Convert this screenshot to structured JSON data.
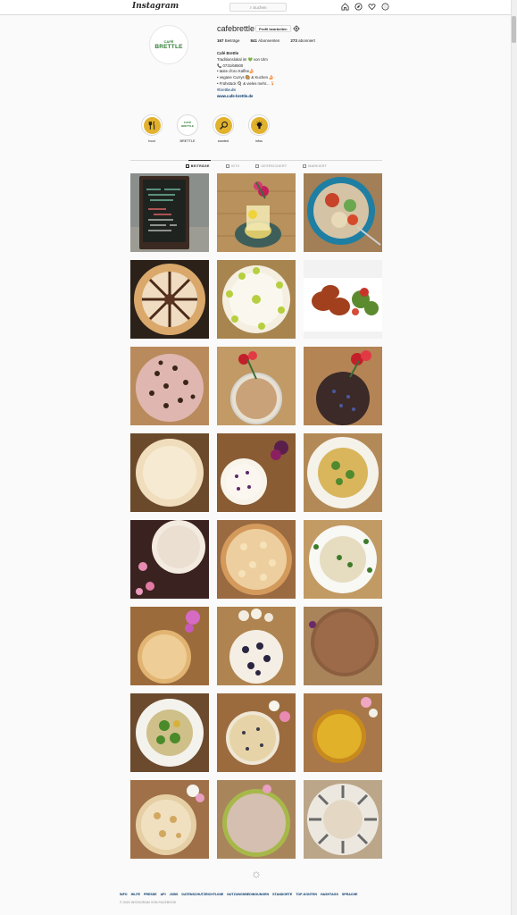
{
  "header": {
    "logo": "Instagram",
    "search_placeholder": "Suchen"
  },
  "profile": {
    "avatar_small": "CAFÉ",
    "avatar_big": "BRETTLE",
    "username": "cafebrettle",
    "edit_label": "Profil bearbeiten",
    "stats": [
      {
        "count": "167",
        "label": "Beiträge"
      },
      {
        "count": "841",
        "label": "Abonnenten"
      },
      {
        "count": "273",
        "label": "abonniert"
      }
    ],
    "bio": {
      "name": "Café Brettle",
      "line1": "Traditionslokal im 💚 von Ulm",
      "phone": "📞 0731/68500",
      "line3": "• taste d'oro Kaffee🍰",
      "line4": "• vegane Currys 🥘 & Kuchen 🍰",
      "line5": "• Frühstück 🍳 & vieles mehr... 🍹",
      "hashtag": "#brettleulm",
      "website": "www.cafe-brettle.de"
    }
  },
  "highlights": [
    {
      "label": "food",
      "icon": "fork-knife-icon"
    },
    {
      "label": "BRETTLE",
      "icon": "brettle-logo"
    },
    {
      "label": "wanted",
      "icon": "magnifier-icon"
    },
    {
      "label": "infos",
      "icon": "lightbulb-icon"
    }
  ],
  "tabs": [
    {
      "label": "BEITRÄGE",
      "active": true
    },
    {
      "label": "IGTV",
      "active": false
    },
    {
      "label": "GESPEICHERT",
      "active": false
    },
    {
      "label": "MARKIERT",
      "active": false
    }
  ],
  "posts": [
    {
      "id": "chalkboard",
      "alt": "chalkboard sign"
    },
    {
      "id": "drink",
      "alt": "lemon drink"
    },
    {
      "id": "noodle-bowl",
      "alt": "noodle bowl"
    },
    {
      "id": "choc-cake",
      "alt": "chocolate cake"
    },
    {
      "id": "lime-cake",
      "alt": "lime cake"
    },
    {
      "id": "chicken",
      "alt": "fried chicken"
    },
    {
      "id": "berry-cake",
      "alt": "berry cake"
    },
    {
      "id": "crumble-cake",
      "alt": "crumble cake"
    },
    {
      "id": "dark-cake",
      "alt": "dark cake"
    },
    {
      "id": "white-tart",
      "alt": "white tart"
    },
    {
      "id": "berry-tart",
      "alt": "berry tart"
    },
    {
      "id": "pasta",
      "alt": "pasta"
    },
    {
      "id": "coconut-cake",
      "alt": "coconut cake"
    },
    {
      "id": "crumble-pie",
      "alt": "crumble pie"
    },
    {
      "id": "risotto",
      "alt": "risotto"
    },
    {
      "id": "crumb-cake",
      "alt": "crumb cake"
    },
    {
      "id": "blueberry-cake",
      "alt": "blueberry cake"
    },
    {
      "id": "cinnamon-cake",
      "alt": "cinnamon cake"
    },
    {
      "id": "salad",
      "alt": "salad"
    },
    {
      "id": "crumb-tart",
      "alt": "crumb tart"
    },
    {
      "id": "orange-cake",
      "alt": "orange cake"
    },
    {
      "id": "nut-cake",
      "alt": "nut cake"
    },
    {
      "id": "pistachio-cake",
      "alt": "pistachio cake"
    },
    {
      "id": "wafer-cake",
      "alt": "wafer cake"
    }
  ],
  "footer": {
    "links": [
      "INFO",
      "HILFE",
      "PRESSE",
      "API",
      "JOBS",
      "DATENSCHUTZRICHTLINIE",
      "NUTZUNGSBEDINGUNGEN",
      "STANDORTE",
      "TOP-KONTEN",
      "HASHTAGS",
      "SPRACHE"
    ],
    "copyright": "© 2020 INSTAGRAM VON FACEBOOK"
  }
}
